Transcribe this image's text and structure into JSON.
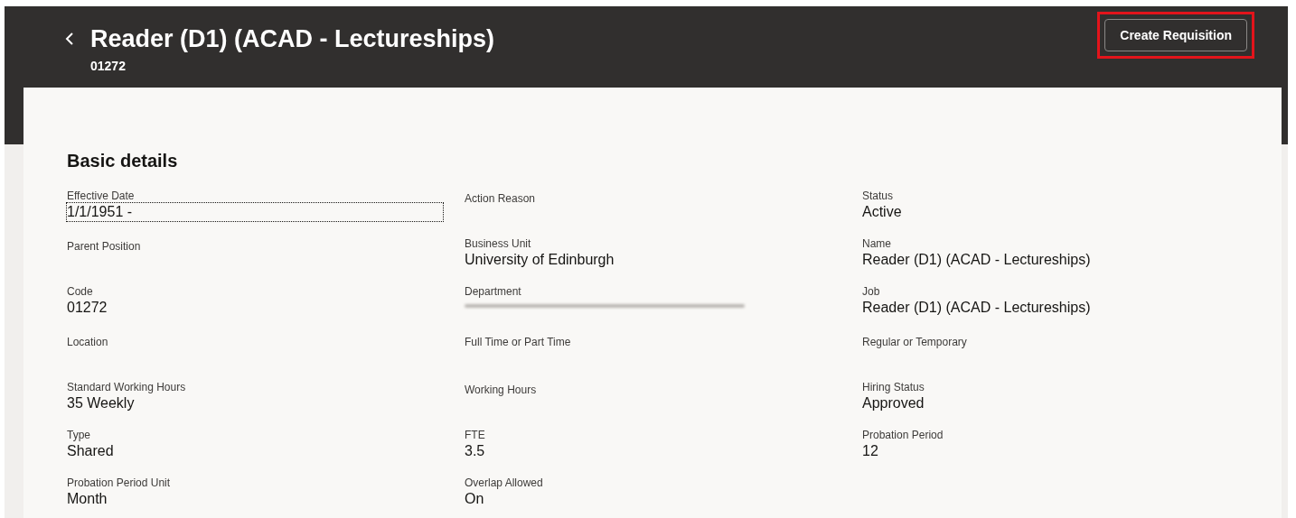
{
  "header": {
    "title": "Reader (D1) (ACAD - Lectureships)",
    "subtitle": "01272",
    "action_button": {
      "label": "Create Requisition",
      "highlighted": true
    }
  },
  "section": {
    "title": "Basic details",
    "fields": [
      {
        "label": "Effective Date",
        "value": "1/1/1951 -",
        "focused": true
      },
      {
        "label": "Action Reason",
        "focused": false
      },
      {
        "label": "Status",
        "value": "Active",
        "focused": false
      },
      {
        "label": "Parent Position",
        "focused": false
      },
      {
        "label": "Business Unit",
        "value": "University of Edinburgh",
        "focused": false
      },
      {
        "label": "Name",
        "value": "Reader (D1) (ACAD - Lectureships)",
        "focused": false
      },
      {
        "label": "Code",
        "value": "01272",
        "focused": false
      },
      {
        "label": "Department",
        "kind": "redacted",
        "focused": false
      },
      {
        "label": "Job",
        "value": "Reader (D1) (ACAD - Lectureships)",
        "focused": false
      },
      {
        "label": "Location",
        "focused": false
      },
      {
        "label": "Full Time or Part Time",
        "focused": false
      },
      {
        "label": "Regular or Temporary",
        "focused": false
      },
      {
        "label": "Standard Working Hours",
        "value": "35 Weekly",
        "focused": false
      },
      {
        "label": "Working Hours",
        "focused": false
      },
      {
        "label": "Hiring Status",
        "value": "Approved",
        "focused": false
      },
      {
        "label": "Type",
        "value": "Shared",
        "focused": false
      },
      {
        "label": "FTE",
        "value": "3.5",
        "focused": false
      },
      {
        "label": "Probation Period",
        "value": "12",
        "focused": false
      },
      {
        "label": "Probation Period Unit",
        "value": "Month",
        "focused": false
      },
      {
        "label": "Overlap Allowed",
        "value": "On",
        "focused": false
      }
    ]
  }
}
